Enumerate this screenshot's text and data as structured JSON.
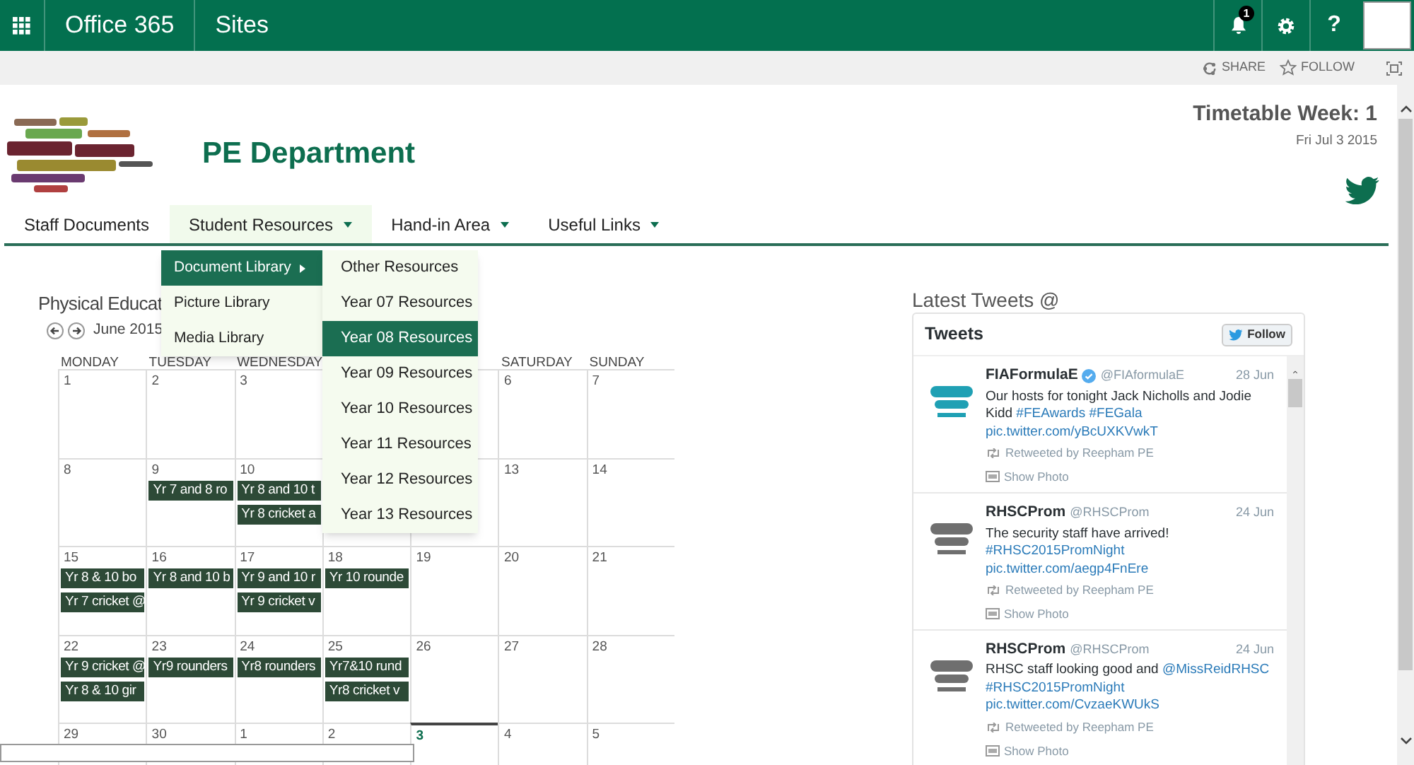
{
  "top_bar": {
    "brand": "Office 365",
    "section": "Sites",
    "notification_count": "1",
    "help_label": "?"
  },
  "actions": [
    "SHARE",
    "FOLLOW"
  ],
  "site": {
    "title": "PE Department",
    "week": "Timetable Week: 1",
    "date": "Fri Jul 3 2015"
  },
  "nav": [
    {
      "label": "Staff Documents",
      "dropdown": false,
      "selected": false
    },
    {
      "label": "Student Resources",
      "dropdown": true,
      "selected": true
    },
    {
      "label": "Hand-in Area",
      "dropdown": true,
      "selected": false
    },
    {
      "label": "Useful Links",
      "dropdown": true,
      "selected": false
    }
  ],
  "menu": {
    "items": [
      {
        "label": "Document Library",
        "submenu": true,
        "selected": true
      },
      {
        "label": "Picture Library",
        "submenu": false,
        "selected": false
      },
      {
        "label": "Media Library",
        "submenu": false,
        "selected": false
      }
    ],
    "submenu": [
      {
        "label": "Other Resources",
        "selected": false
      },
      {
        "label": "Year 07 Resources",
        "selected": false
      },
      {
        "label": "Year 08 Resources",
        "selected": true
      },
      {
        "label": "Year 09 Resources",
        "selected": false
      },
      {
        "label": "Year 10 Resources",
        "selected": false
      },
      {
        "label": "Year 11 Resources",
        "selected": false
      },
      {
        "label": "Year 12 Resources",
        "selected": false
      },
      {
        "label": "Year 13 Resources",
        "selected": false
      }
    ]
  },
  "calendar": {
    "title": "Physical Educat",
    "month": "June 2015",
    "weekdays": [
      {
        "kind": "label",
        "text": "MONDAY"
      },
      {
        "kind": "label",
        "text": "TUESDAY"
      },
      {
        "kind": "label",
        "text": "WEDNESDAY"
      },
      {
        "kind": "covered"
      },
      {
        "kind": "covered"
      },
      {
        "kind": "label",
        "text": "SATURDAY"
      },
      {
        "kind": "label",
        "text": "SUNDAY"
      }
    ],
    "weeks": [
      {
        "days": [
          {
            "kind": "day",
            "date": "1",
            "today": false
          },
          {
            "kind": "day",
            "date": "2",
            "today": false
          },
          {
            "kind": "day",
            "date": "3",
            "today": false
          },
          {
            "kind": "covered"
          },
          {
            "kind": "covered"
          },
          {
            "kind": "day",
            "date": "6",
            "today": false
          },
          {
            "kind": "day",
            "date": "7",
            "today": false
          }
        ]
      },
      {
        "days": [
          {
            "kind": "day",
            "date": "8",
            "today": false
          },
          {
            "kind": "day",
            "date": "9",
            "today": false,
            "events": [
              "Yr 7 and 8 ro"
            ]
          },
          {
            "kind": "day",
            "date": "10",
            "today": false,
            "events": [
              "Yr 8 and 10 t",
              "Yr 8 cricket a"
            ]
          },
          {
            "kind": "covered"
          },
          {
            "kind": "covered"
          },
          {
            "kind": "day",
            "date": "13",
            "today": false
          },
          {
            "kind": "day",
            "date": "14",
            "today": false
          }
        ]
      },
      {
        "days": [
          {
            "kind": "day",
            "date": "15",
            "today": false,
            "events": [
              "Yr 8 & 10 bo",
              "Yr 7 cricket @"
            ]
          },
          {
            "kind": "day",
            "date": "16",
            "today": false,
            "events": [
              "Yr 8 and 10 b"
            ]
          },
          {
            "kind": "day",
            "date": "17",
            "today": false,
            "events": [
              "Yr 9 and 10 r",
              "Yr 9 cricket v"
            ]
          },
          {
            "kind": "day",
            "date": "18",
            "today": false,
            "events": [
              "Yr 10 rounde"
            ]
          },
          {
            "kind": "day",
            "date": "19",
            "today": false
          },
          {
            "kind": "day",
            "date": "20",
            "today": false
          },
          {
            "kind": "day",
            "date": "21",
            "today": false
          }
        ]
      },
      {
        "days": [
          {
            "kind": "day",
            "date": "22",
            "today": false,
            "events": [
              "Yr 9 cricket @",
              "Yr 8 & 10 gir"
            ]
          },
          {
            "kind": "day",
            "date": "23",
            "today": false,
            "events": [
              "Yr9 rounders"
            ]
          },
          {
            "kind": "day",
            "date": "24",
            "today": false,
            "events": [
              "Yr8 rounders"
            ]
          },
          {
            "kind": "day",
            "date": "25",
            "today": false,
            "events": [
              "Yr7&10 rund",
              "Yr8 cricket v"
            ]
          },
          {
            "kind": "day",
            "date": "26",
            "today": false
          },
          {
            "kind": "day",
            "date": "27",
            "today": false
          },
          {
            "kind": "day",
            "date": "28",
            "today": false
          }
        ]
      },
      {
        "days": [
          {
            "kind": "day",
            "date": "29",
            "today": false
          },
          {
            "kind": "day",
            "date": "30",
            "today": false
          },
          {
            "kind": "day",
            "date": "1",
            "today": false
          },
          {
            "kind": "day",
            "date": "2",
            "today": false
          },
          {
            "kind": "day",
            "date": "3",
            "today": true
          },
          {
            "kind": "day",
            "date": "4",
            "today": false
          },
          {
            "kind": "day",
            "date": "5",
            "today": false
          }
        ]
      }
    ]
  },
  "tweets": {
    "heading": "Latest Tweets @",
    "title": "Tweets",
    "follow": "Follow",
    "items": [
      {
        "name": "FIAFormulaE",
        "verified": true,
        "handle": "@FIAformulaE",
        "date": "28 Jun",
        "avatar": {
          "kind": "picture",
          "color": "#1fa0b4"
        },
        "text": [
          {
            "kind": "text",
            "text": "Our hosts for tonight Jack Nicholls and Jodie Kidd"
          },
          {
            "kind": "link",
            "text": "#FEAwards"
          },
          {
            "kind": "link",
            "text": "#FEGala"
          },
          {
            "kind": "link",
            "text": "pic.twitter.com/yBcUXKVwkT"
          }
        ],
        "retweeted": "Retweeted by Reepham PE",
        "photo": "Show Photo"
      },
      {
        "name": "RHSCProm",
        "verified": false,
        "handle": "@RHSCProm",
        "date": "24 Jun",
        "avatar": {
          "kind": "picture",
          "color": "#6f6f6f"
        },
        "text": [
          {
            "kind": "text",
            "text": "The security staff have arrived!"
          },
          {
            "kind": "link",
            "text": "#RHSC2015PromNight"
          },
          {
            "kind": "link",
            "text": "pic.twitter.com/aegp4FnEre"
          }
        ],
        "retweeted": "Retweeted by Reepham PE",
        "photo": "Show Photo"
      },
      {
        "name": "RHSCProm",
        "verified": false,
        "handle": "@RHSCProm",
        "date": "24 Jun",
        "avatar": {
          "kind": "picture",
          "color": "#6f6f6f"
        },
        "text": [
          {
            "kind": "text",
            "text": "RHSC staff looking good and"
          },
          {
            "kind": "link",
            "text": "@MissReidRHSC"
          },
          {
            "kind": "link",
            "text": "#RHSC2015PromNight"
          },
          {
            "kind": "link",
            "text": "pic.twitter.com/CvzaeKWUkS"
          }
        ],
        "retweeted": "Retweeted by Reepham PE",
        "photo": "Show Photo"
      }
    ]
  }
}
